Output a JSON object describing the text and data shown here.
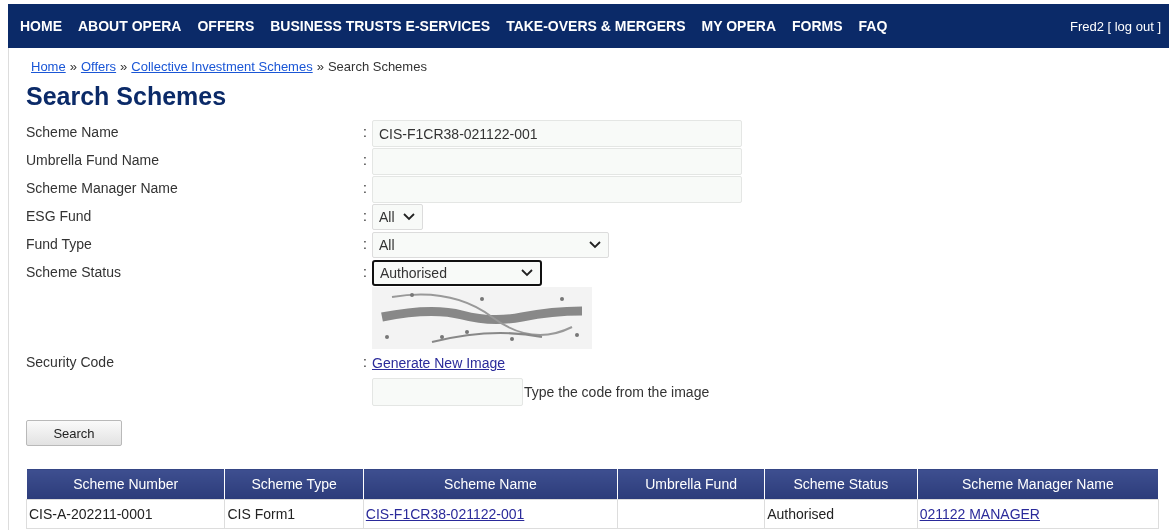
{
  "nav": {
    "items": [
      "HOME",
      "ABOUT OPERA",
      "OFFERS",
      "BUSINESS TRUSTS E-SERVICES",
      "TAKE-OVERS & MERGERS",
      "MY OPERA",
      "FORMS",
      "FAQ"
    ],
    "user": "Fred2 [ log out ]"
  },
  "breadcrumb": {
    "links": [
      "Home",
      "Offers",
      "Collective Investment Schemes"
    ],
    "separators": [
      "»",
      "»",
      "»"
    ],
    "current": "Search Schemes"
  },
  "title": "Search Schemes",
  "form": {
    "fields": [
      {
        "label": "Scheme Name",
        "colon": ":",
        "kind": "text",
        "value": "CIS-F1CR38-021122-001",
        "focused": false
      },
      {
        "label": "Umbrella Fund Name",
        "colon": ":",
        "kind": "text",
        "focused": false
      },
      {
        "label": "Scheme Manager Name",
        "colon": ":",
        "kind": "text",
        "focused": false
      },
      {
        "label": "ESG Fund",
        "colon": ":",
        "kind": "select",
        "value": "All",
        "focused": false
      },
      {
        "label": "Fund Type",
        "colon": ":",
        "kind": "select",
        "value": "All",
        "focused": false
      },
      {
        "label": "Scheme Status",
        "colon": ":",
        "kind": "select",
        "value": "Authorised",
        "focused": true
      }
    ],
    "security": {
      "label": "Security Code",
      "colon": ":",
      "link": "Generate New Image",
      "hint": "Type the code from the image"
    },
    "submit": "Search"
  },
  "table": {
    "columns": [
      "Scheme Number",
      "Scheme Type",
      "Scheme Name",
      "Umbrella Fund",
      "Scheme Status",
      "Scheme Manager Name"
    ],
    "rows": [
      {
        "cells": [
          {
            "text": "CIS-A-202211-0001",
            "kind": "text"
          },
          {
            "text": "CIS Form1",
            "kind": "text"
          },
          {
            "text": "CIS-F1CR38-021122-001",
            "kind": "link"
          },
          {
            "text": "",
            "kind": "text"
          },
          {
            "text": "Authorised",
            "kind": "text"
          },
          {
            "text": "021122 MANAGER",
            "kind": "link"
          }
        ]
      }
    ]
  }
}
